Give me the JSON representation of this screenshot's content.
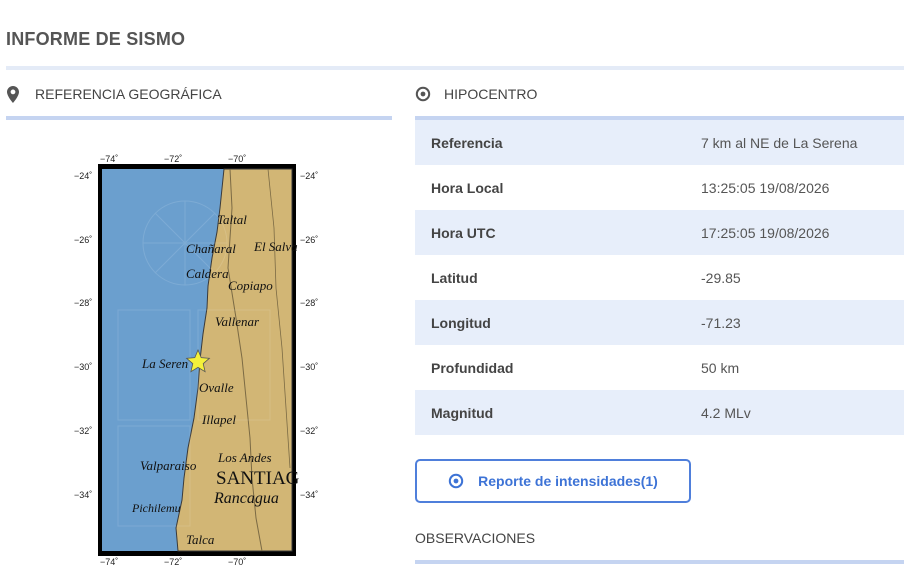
{
  "page": {
    "title": "INFORME DE SISMO"
  },
  "geo_section": {
    "label": "REFERENCIA GEOGRÁFICA",
    "icon": "map-pin-icon"
  },
  "hipo_section": {
    "label": "HIPOCENTRO",
    "icon": "target-icon"
  },
  "map": {
    "lon_ticks": [
      "−74˚",
      "−72˚",
      "−70˚"
    ],
    "lat_ticks": [
      "−24˚",
      "−26˚",
      "−28˚",
      "−30˚",
      "−32˚",
      "−34˚"
    ],
    "places": [
      "Taltal",
      "Chañaral",
      "El Salva",
      "Caldera",
      "Copiapo",
      "Vallenar",
      "La Seren",
      "Ovalle",
      "Illapel",
      "Los Andes",
      "Valparaiso",
      "SANTIAG",
      "Rancagua",
      "Pichilemu",
      "Talca"
    ],
    "epicenter_marker": "star-icon",
    "colors": {
      "ocean": "#6b9fce",
      "land": "#d2b675",
      "marker": "#f4f13a"
    }
  },
  "hipocentro": {
    "rows": [
      {
        "key": "Referencia",
        "value": "7 km al NE de La Serena"
      },
      {
        "key": "Hora Local",
        "value": "13:25:05 19/08/2026"
      },
      {
        "key": "Hora UTC",
        "value": "17:25:05 19/08/2026"
      },
      {
        "key": "Latitud",
        "value": "-29.85"
      },
      {
        "key": "Longitud",
        "value": "-71.23"
      },
      {
        "key": "Profundidad",
        "value": "50 km"
      },
      {
        "key": "Magnitud",
        "value": "4.2 MLv"
      }
    ]
  },
  "report_button": {
    "label": "Reporte de intensidades(1)",
    "icon": "target-icon"
  },
  "observaciones": {
    "label": "OBSERVACIONES"
  },
  "colors": {
    "accent": "#3d73d6",
    "rule": "#c5d4f1",
    "row_alt": "#e7eefa"
  }
}
